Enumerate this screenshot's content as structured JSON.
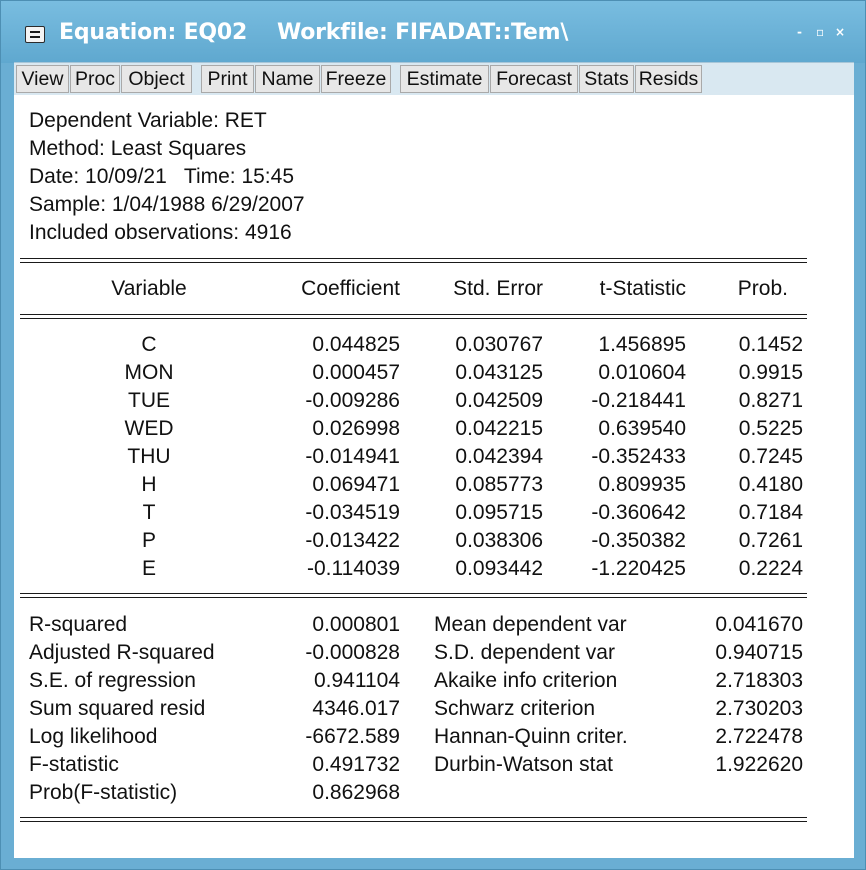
{
  "window": {
    "title": "Equation: EQ02    Workfile: FIFADAT::Tem\\",
    "controls": {
      "minimize": "-",
      "restore": "▫",
      "close": "×"
    }
  },
  "toolbar": {
    "buttons": [
      "View",
      "Proc",
      "Object",
      "Print",
      "Name",
      "Freeze",
      "Estimate",
      "Forecast",
      "Stats",
      "Resids"
    ]
  },
  "header": {
    "dependent": "Dependent Variable: RET",
    "method": "Method: Least Squares",
    "date": "Date: 10/09/21   Time: 15:45",
    "sample": "Sample: 1/04/1988 6/29/2007",
    "observations": "Included observations: 4916"
  },
  "table": {
    "columns": [
      "Variable",
      "Coefficient",
      "Std. Error",
      "t-Statistic",
      "Prob."
    ],
    "rows": [
      [
        "C",
        "0.044825",
        "0.030767",
        "1.456895",
        "0.1452"
      ],
      [
        "MON",
        "0.000457",
        "0.043125",
        "0.010604",
        "0.9915"
      ],
      [
        "TUE",
        "-0.009286",
        "0.042509",
        "-0.218441",
        "0.8271"
      ],
      [
        "WED",
        "0.026998",
        "0.042215",
        "0.639540",
        "0.5225"
      ],
      [
        "THU",
        "-0.014941",
        "0.042394",
        "-0.352433",
        "0.7245"
      ],
      [
        "H",
        "0.069471",
        "0.085773",
        "0.809935",
        "0.4180"
      ],
      [
        "T",
        "-0.034519",
        "0.095715",
        "-0.360642",
        "0.7184"
      ],
      [
        "P",
        "-0.013422",
        "0.038306",
        "-0.350382",
        "0.7261"
      ],
      [
        "E",
        "-0.114039",
        "0.093442",
        "-1.220425",
        "0.2224"
      ]
    ]
  },
  "stats": {
    "left": [
      [
        "R-squared",
        "0.000801"
      ],
      [
        "Adjusted R-squared",
        "-0.000828"
      ],
      [
        "S.E. of regression",
        "0.941104"
      ],
      [
        "Sum squared resid",
        "4346.017"
      ],
      [
        "Log likelihood",
        "-6672.589"
      ],
      [
        "F-statistic",
        "0.491732"
      ],
      [
        "Prob(F-statistic)",
        "0.862968"
      ]
    ],
    "right": [
      [
        "Mean dependent var",
        "0.041670"
      ],
      [
        "S.D. dependent var",
        "0.940715"
      ],
      [
        "Akaike info criterion",
        "2.718303"
      ],
      [
        "Schwarz criterion",
        "2.730203"
      ],
      [
        "Hannan-Quinn criter.",
        "2.722478"
      ],
      [
        "Durbin-Watson stat",
        "1.922620"
      ]
    ]
  }
}
